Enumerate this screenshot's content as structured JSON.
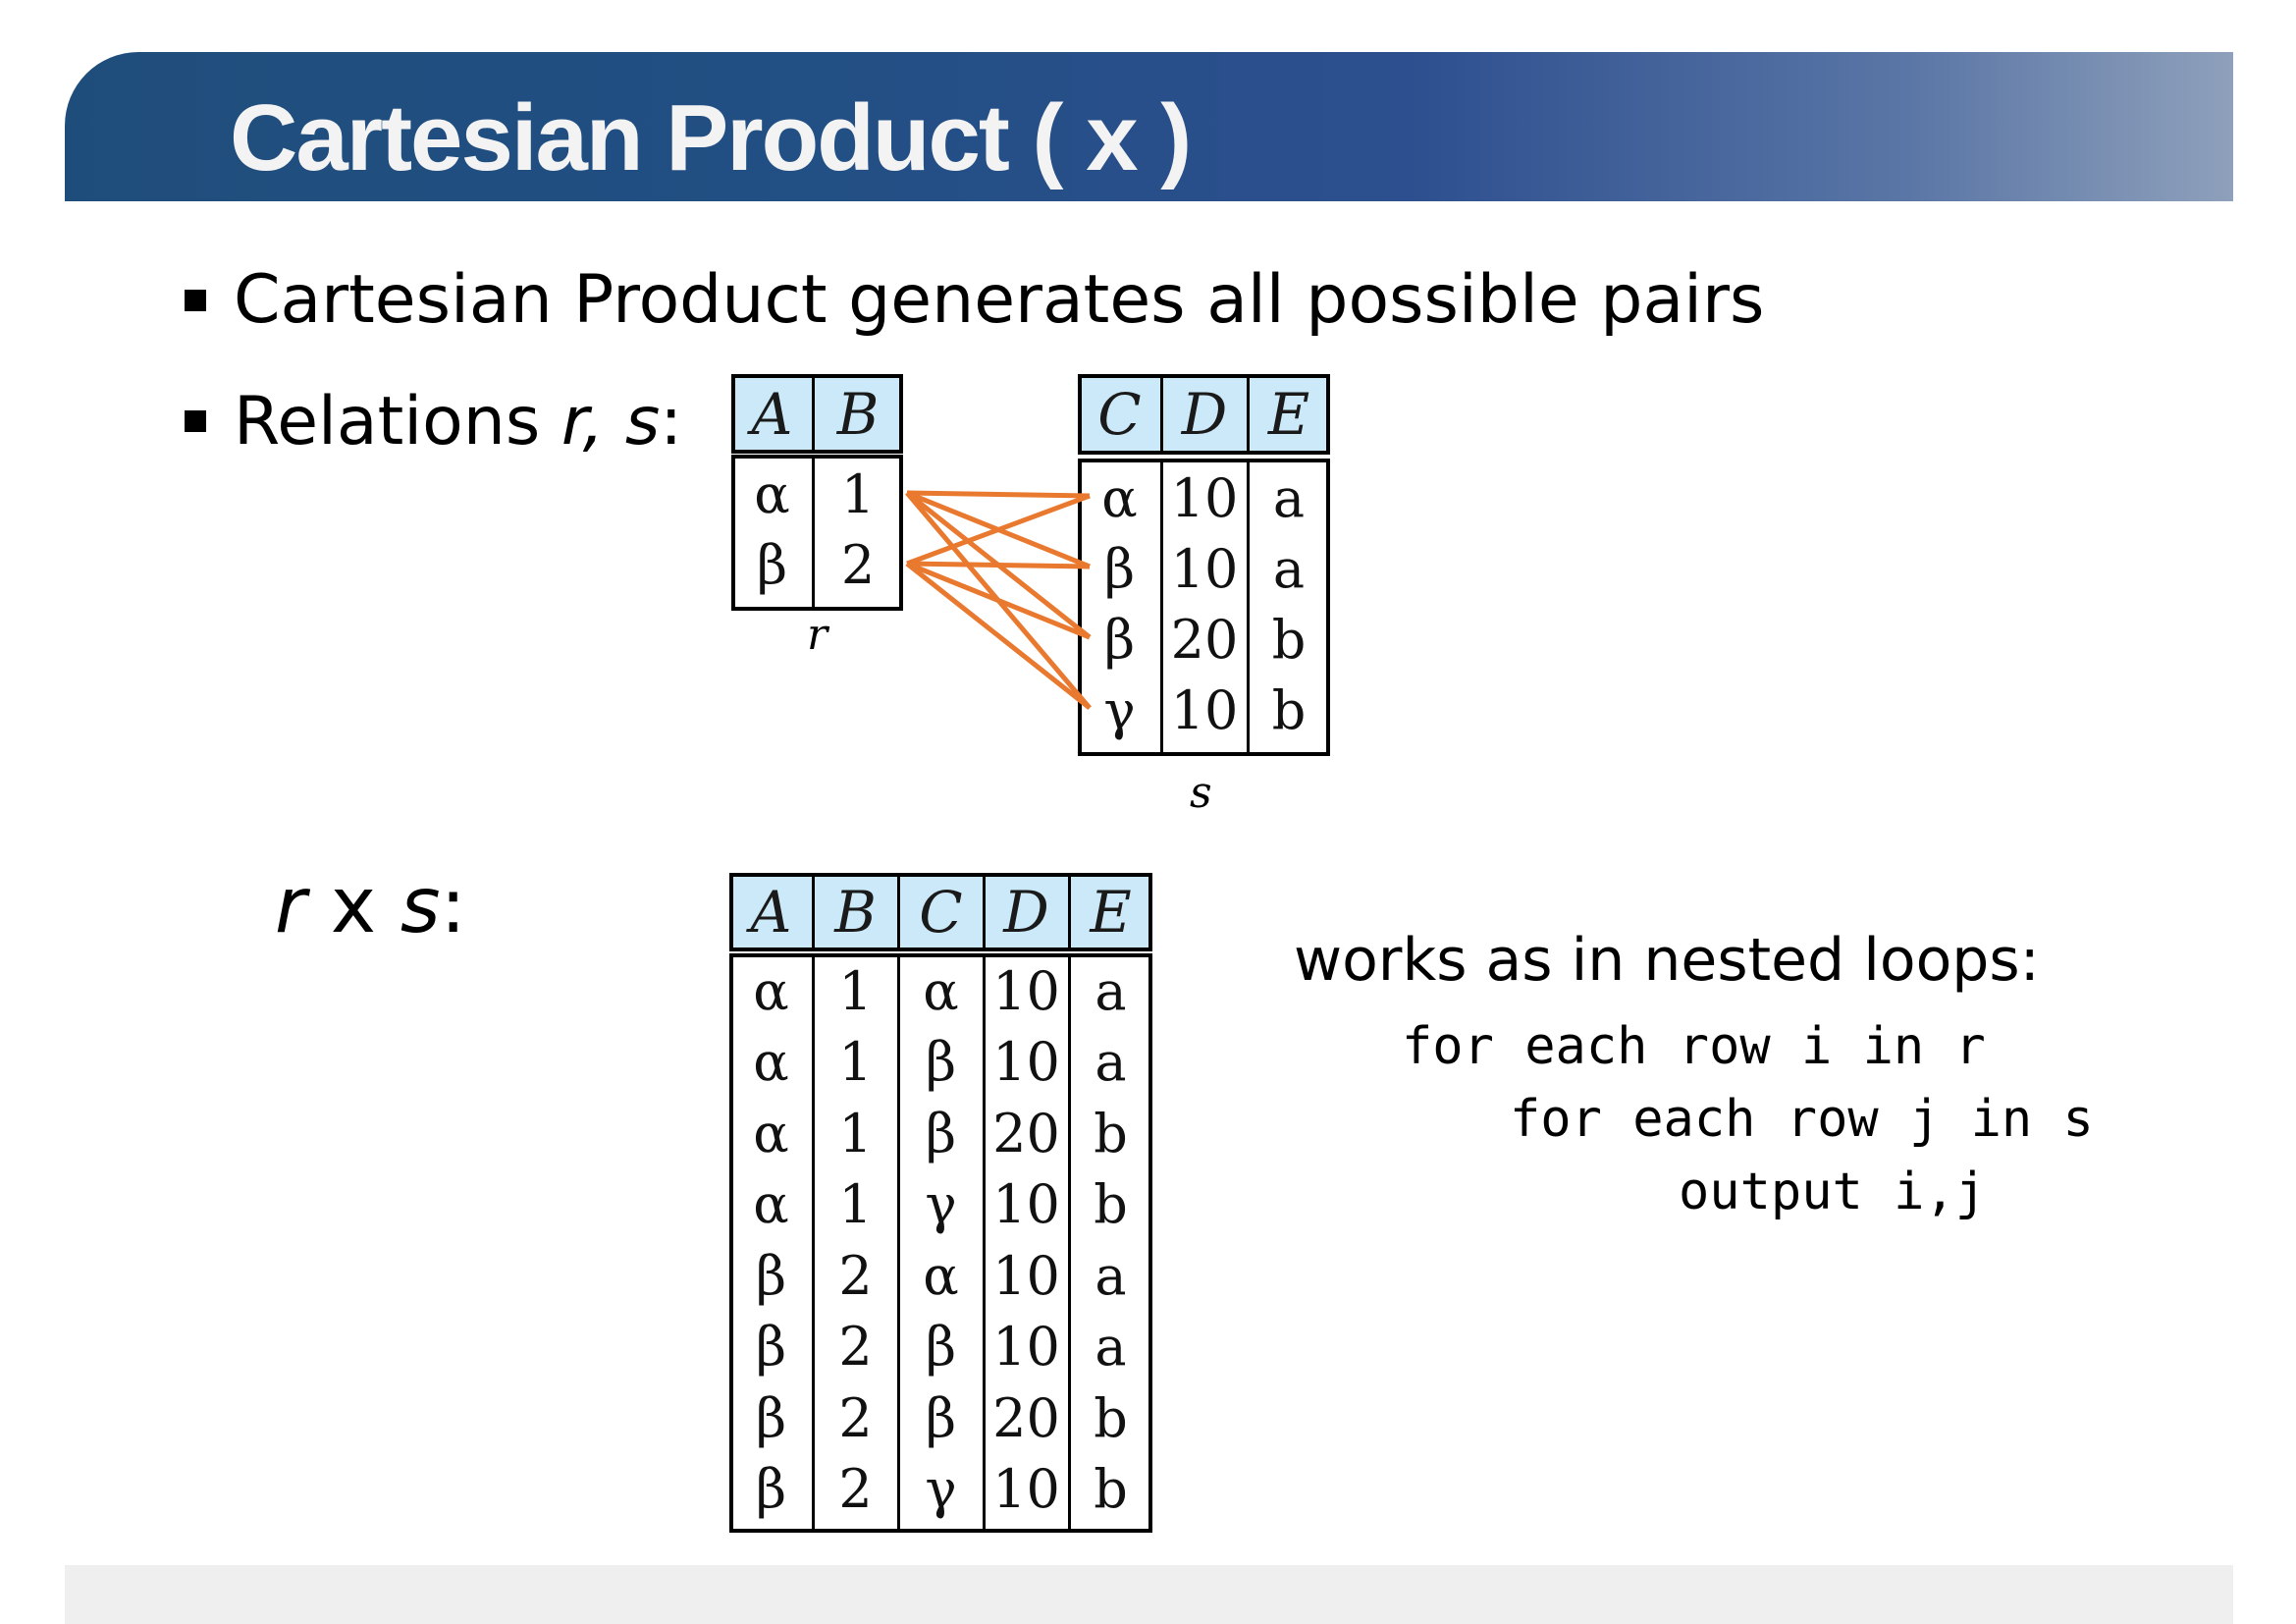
{
  "title": "Cartesian Product ( x )",
  "bullets": {
    "b1": "Cartesian Product generates all possible pairs",
    "b2_prefix": "Relations ",
    "b2_vars": "r, s",
    "b2_suffix": ":"
  },
  "relation_r": {
    "name": "r",
    "headers": [
      "A",
      "B"
    ],
    "rows": [
      [
        "α",
        "1"
      ],
      [
        "β",
        "2"
      ]
    ]
  },
  "relation_s": {
    "name": "s",
    "headers": [
      "C",
      "D",
      "E"
    ],
    "rows": [
      [
        "α",
        "10",
        "a"
      ],
      [
        "β",
        "10",
        "a"
      ],
      [
        "β",
        "20",
        "b"
      ],
      [
        "γ",
        "10",
        "b"
      ]
    ]
  },
  "product_label": {
    "r": "r",
    "x": " x ",
    "s": "s",
    "colon": ":"
  },
  "product": {
    "headers": [
      "A",
      "B",
      "C",
      "D",
      "E"
    ],
    "rows": [
      [
        "α",
        "1",
        "α",
        "10",
        "a"
      ],
      [
        "α",
        "1",
        "β",
        "10",
        "a"
      ],
      [
        "α",
        "1",
        "β",
        "20",
        "b"
      ],
      [
        "α",
        "1",
        "γ",
        "10",
        "b"
      ],
      [
        "β",
        "2",
        "α",
        "10",
        "a"
      ],
      [
        "β",
        "2",
        "β",
        "10",
        "a"
      ],
      [
        "β",
        "2",
        "β",
        "20",
        "b"
      ],
      [
        "β",
        "2",
        "γ",
        "10",
        "b"
      ]
    ]
  },
  "explanation": {
    "heading": "works as in nested loops:",
    "code": [
      "for each row i in r",
      "for each row j in s",
      "output i,j"
    ]
  },
  "colors": {
    "title_bar_start": "#1f4d7b",
    "title_bar_end": "#8ea0bb",
    "header_fill": "#cbe9f8",
    "connector": "#e8792f"
  }
}
